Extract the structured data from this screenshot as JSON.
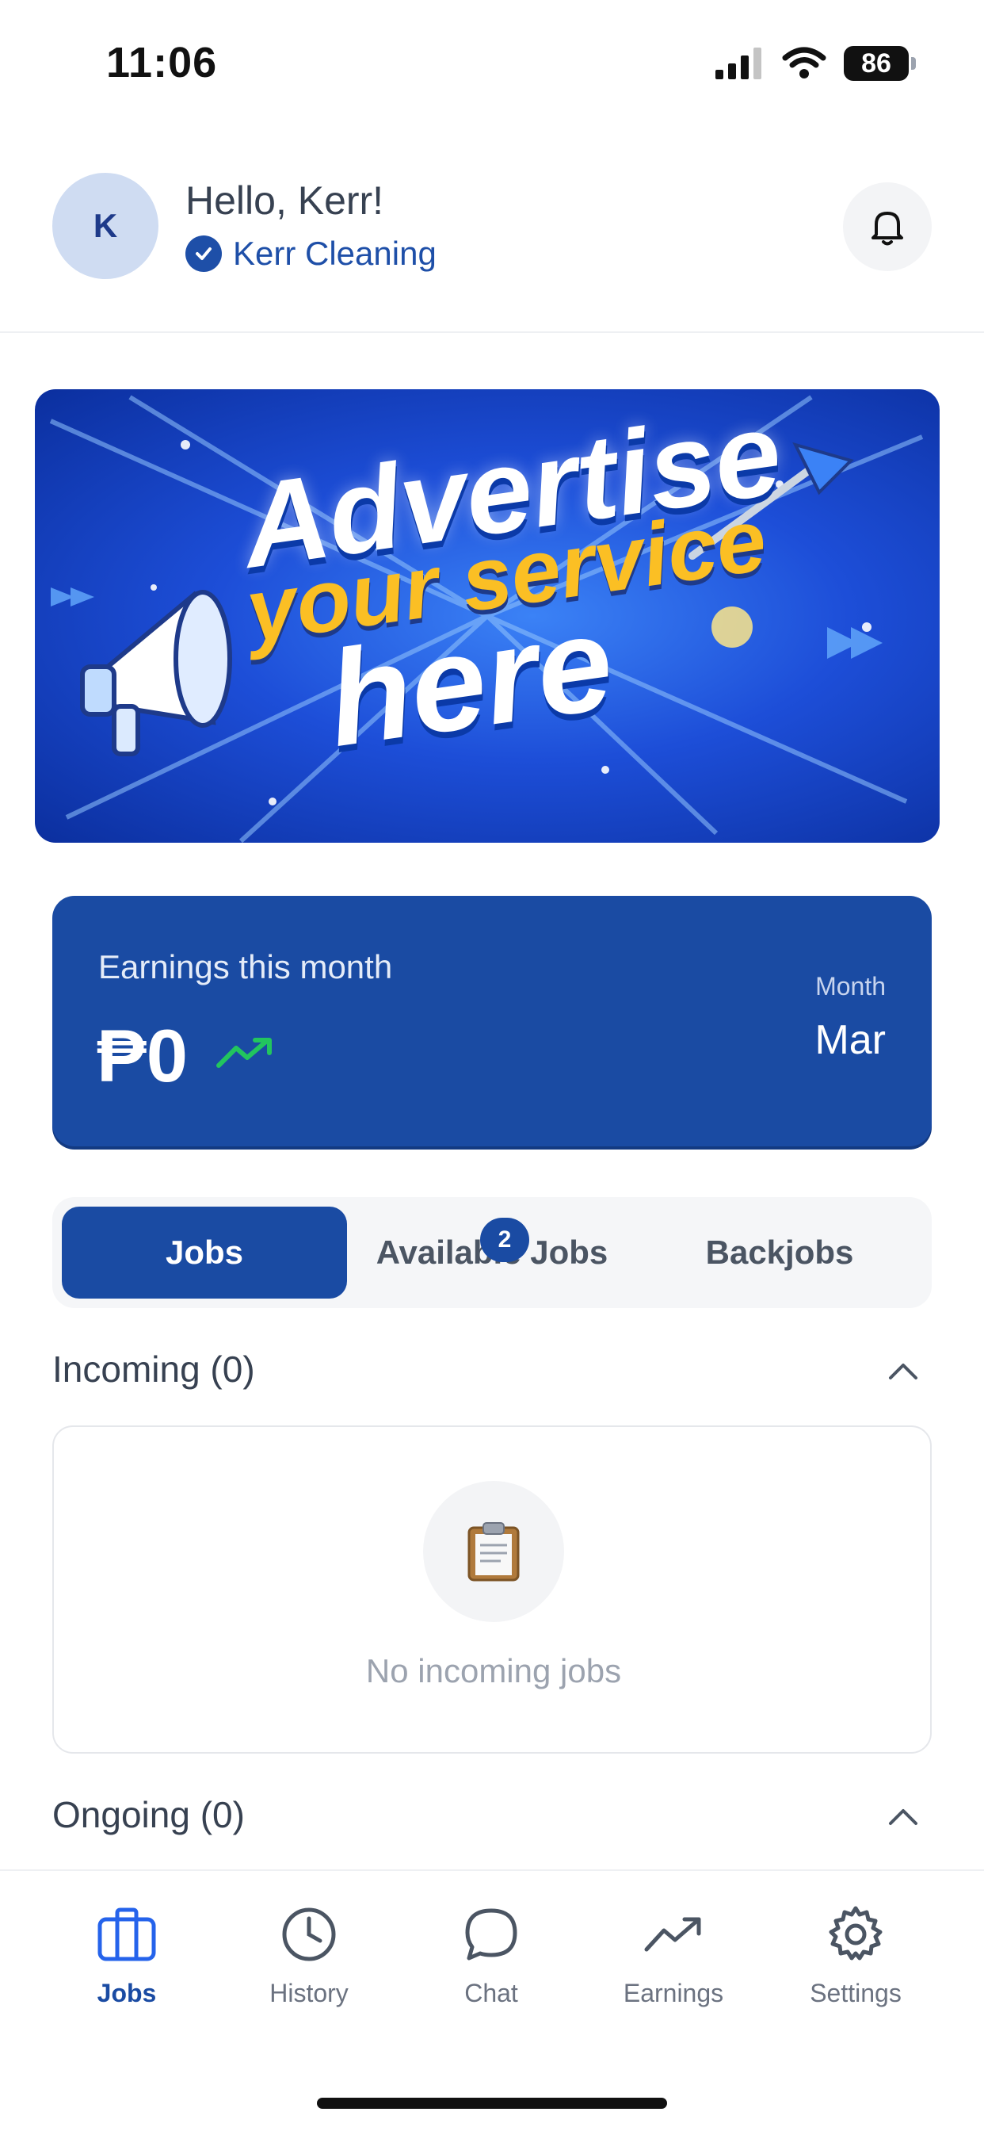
{
  "status_bar": {
    "time": "11:06",
    "battery": "86"
  },
  "header": {
    "avatar_initial": "K",
    "greeting": "Hello, Kerr!",
    "business_name": "Kerr Cleaning"
  },
  "banner": {
    "line1": "Advertise",
    "line2": "your service",
    "line3": "here"
  },
  "earnings": {
    "label": "Earnings this month",
    "value": "₱0",
    "month_label": "Month",
    "month_value": "Mar"
  },
  "tabs": {
    "jobs": "Jobs",
    "available_jobs": "Available Jobs",
    "available_badge": "2",
    "backjobs": "Backjobs"
  },
  "incoming": {
    "title": "Incoming (0)",
    "empty_text": "No incoming jobs"
  },
  "ongoing": {
    "title": "Ongoing (0)"
  },
  "nav": {
    "jobs": "Jobs",
    "history": "History",
    "chat": "Chat",
    "earnings": "Earnings",
    "settings": "Settings"
  },
  "colors": {
    "primary": "#1a4ba3",
    "accent_green": "#22c55e",
    "banner_yellow": "#fbbf24"
  }
}
